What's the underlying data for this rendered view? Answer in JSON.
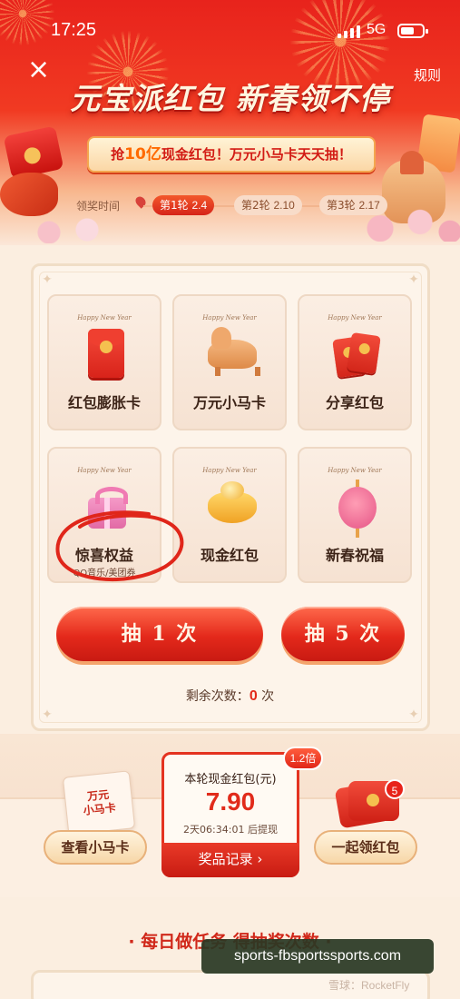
{
  "status_bar": {
    "time": "17:25",
    "network": "5G"
  },
  "header": {
    "close_label": "×",
    "rules_label": "规则",
    "headline": "元宝派红包 新春领不停",
    "banner": {
      "prefix": "抢",
      "highlight": "10亿",
      "suffix": "现金红包！万元小马卡天天抽！"
    }
  },
  "timeline": {
    "label": "领奖时间",
    "rounds": [
      {
        "name": "第1轮",
        "date": "2.4",
        "active": true
      },
      {
        "name": "第2轮",
        "date": "2.10",
        "active": false
      },
      {
        "name": "第3轮",
        "date": "2.17",
        "active": false
      }
    ]
  },
  "prizes": [
    {
      "tag": "Happy New Year",
      "label": "红包膨胀卡",
      "sub": "",
      "icon": "red-envelope-icon"
    },
    {
      "tag": "Happy New Year",
      "label": "万元小马卡",
      "sub": "",
      "icon": "horse-icon"
    },
    {
      "tag": "Happy New Year",
      "label": "分享红包",
      "sub": "",
      "icon": "twin-envelope-icon"
    },
    {
      "tag": "Happy New Year",
      "label": "惊喜权益",
      "sub": "QQ音乐/美团券",
      "icon": "gift-box-icon"
    },
    {
      "tag": "Happy New Year",
      "label": "现金红包",
      "sub": "",
      "icon": "gold-ingot-icon"
    },
    {
      "tag": "Happy New Year",
      "label": "新春祝福",
      "sub": "",
      "icon": "lantern-icon"
    }
  ],
  "draw": {
    "once_label": "抽 1 次",
    "five_label": "抽 5 次",
    "remaining_label": "剩余次数：",
    "remaining_count": "0",
    "remaining_unit": " 次"
  },
  "cash": {
    "title": "本轮现金红包(元)",
    "amount": "7.90",
    "timer": "2天06:34:01 后提现",
    "records_label": "奖品记录 ›",
    "multiplier": "1.2倍"
  },
  "left_card": {
    "thumb_text": "万元\n小马卡",
    "button_label": "查看小马卡"
  },
  "right_card": {
    "badge": "5",
    "button_label": "一起领红包"
  },
  "tasks": {
    "heading": "· 每日做任务 得抽奖次数 ·"
  },
  "overlay": {
    "watermark": "sports-fbsportssports.com",
    "credit": "雪球：RocketFly"
  },
  "colors": {
    "primary_red": "#e4291b",
    "header_red": "#e8231c",
    "background": "#fbeee0",
    "board": "#fdf4ea"
  }
}
